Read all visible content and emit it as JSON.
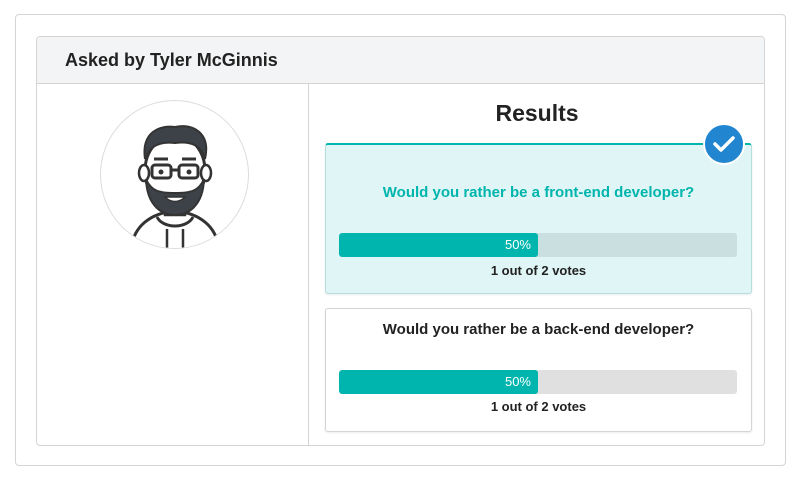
{
  "header": {
    "title": "Asked by Tyler McGinnis"
  },
  "avatar": {
    "icon": "avatar-illustration",
    "alt": "Tyler McGinnis"
  },
  "results": {
    "title": "Results",
    "options": [
      {
        "question": "Would you rather be a front-end developer?",
        "percent": 50,
        "percent_label": "50%",
        "votes_text": "1 out of 2 votes",
        "selected": true
      },
      {
        "question": "Would you rather be a back-end developer?",
        "percent": 50,
        "percent_label": "50%",
        "votes_text": "1 out of 2 votes",
        "selected": false
      }
    ]
  },
  "colors": {
    "accent": "#00b5ad",
    "check": "#2185d0",
    "selected_bg": "#e0f5f5"
  },
  "icons": {
    "check": "check-icon"
  }
}
